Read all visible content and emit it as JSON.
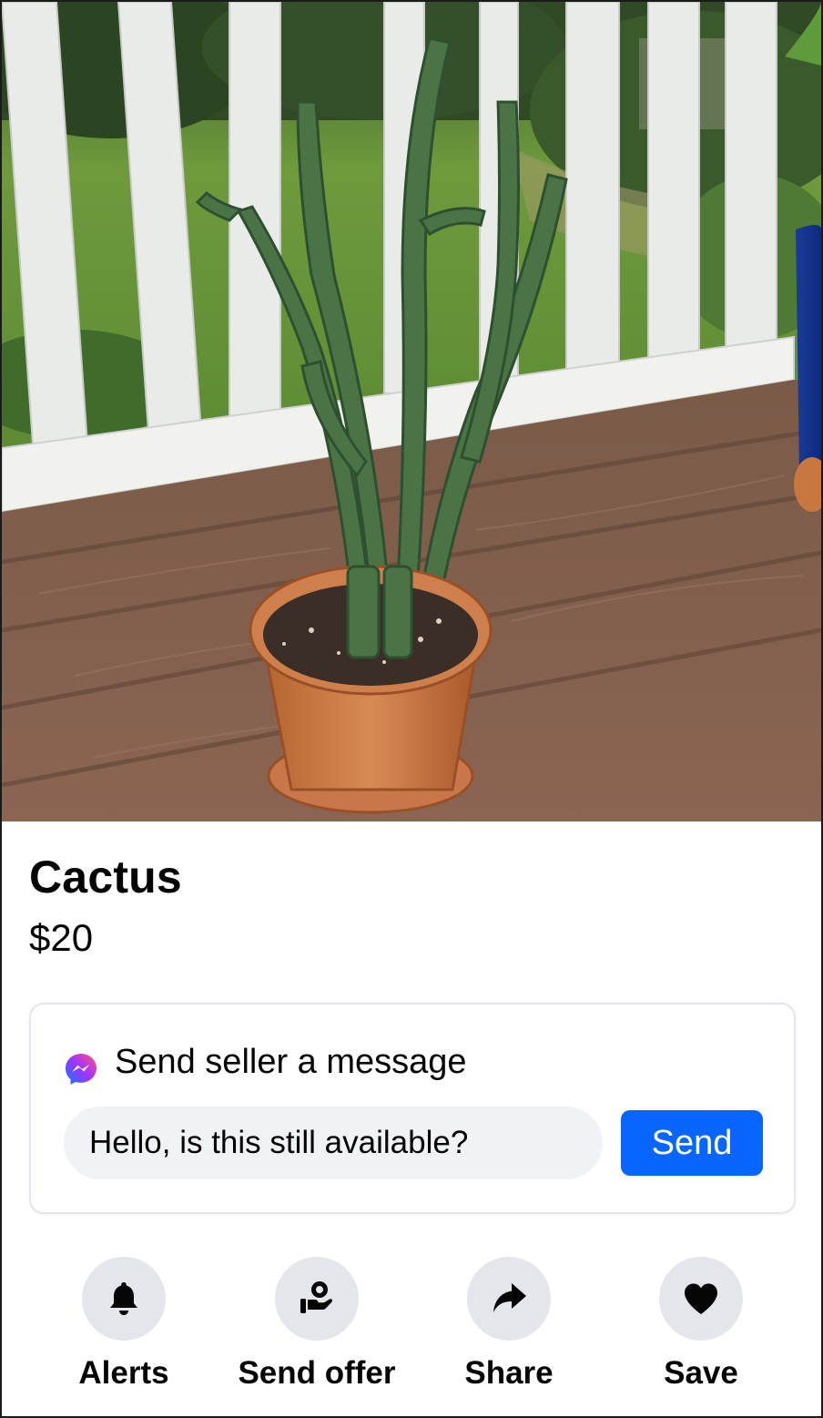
{
  "listing": {
    "photo_alt": "",
    "title": "Cactus",
    "price": "$20"
  },
  "message_card": {
    "icon": "messenger-icon",
    "heading": "Send seller a message",
    "input_value": "Hello, is this still available?",
    "send_label": "Send"
  },
  "actions": [
    {
      "label": "Alerts",
      "icon": "bell-icon"
    },
    {
      "label": "Send offer",
      "icon": "offer-icon"
    },
    {
      "label": "Share",
      "icon": "share-icon"
    },
    {
      "label": "Save",
      "icon": "heart-icon"
    }
  ],
  "colors": {
    "accent": "#0866ff",
    "action_circle": "#e4e6eb",
    "input_bg": "#f0f2f5",
    "card_border": "#e4e6eb"
  }
}
